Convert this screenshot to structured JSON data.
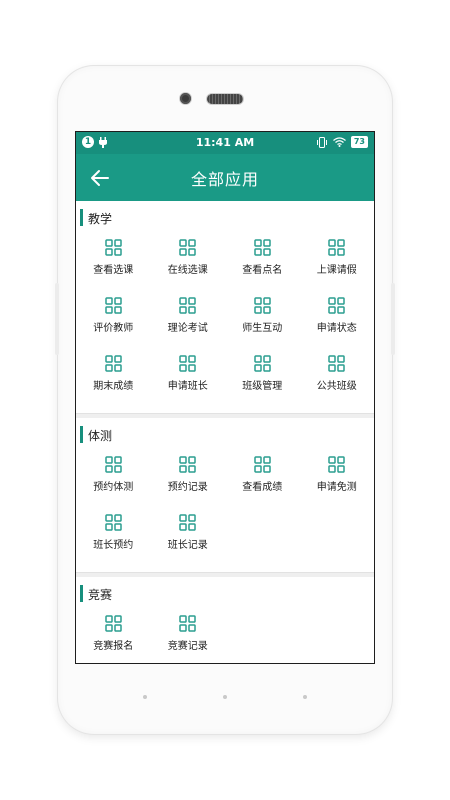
{
  "statusbar": {
    "notification_badge": "1",
    "time": "11:41 AM",
    "battery": "73"
  },
  "appbar": {
    "title": "全部应用"
  },
  "colors": {
    "accent": "#178f7d",
    "appbar": "#1a9a86"
  },
  "sections": [
    {
      "title": "教学",
      "items": [
        "查看选课",
        "在线选课",
        "查看点名",
        "上课请假",
        "评价教师",
        "理论考试",
        "师生互动",
        "申请状态",
        "期末成绩",
        "申请班长",
        "班级管理",
        "公共班级"
      ]
    },
    {
      "title": "体测",
      "items": [
        "预约体测",
        "预约记录",
        "查看成绩",
        "申请免测",
        "班长预约",
        "班长记录"
      ]
    },
    {
      "title": "竞赛",
      "items": [
        "竞赛报名",
        "竞赛记录"
      ]
    }
  ]
}
